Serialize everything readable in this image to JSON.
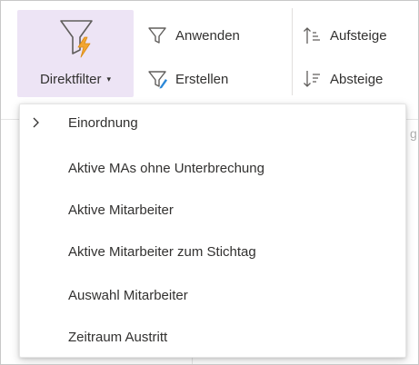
{
  "ribbon": {
    "direktfilter": {
      "label": "Direktfilter",
      "icon": "filter-lightning-icon",
      "caret": "▾"
    },
    "anwenden": {
      "label": "Anwenden",
      "icon": "filter-icon"
    },
    "erstellen": {
      "label": "Erstellen",
      "icon": "filter-edit-icon"
    },
    "aufsteigend": {
      "label": "Aufsteige",
      "icon": "sort-ascending-icon"
    },
    "absteigend": {
      "label": "Absteige",
      "icon": "sort-descending-icon"
    }
  },
  "background": {
    "peek_text": "g"
  },
  "dropdown": {
    "items": [
      {
        "label": "Einordnung",
        "has_submenu": true
      },
      {
        "label": "Aktive MAs ohne Unterbrechung",
        "has_submenu": false
      },
      {
        "label": "Aktive Mitarbeiter",
        "has_submenu": false
      },
      {
        "label": "Aktive Mitarbeiter zum Stichtag",
        "has_submenu": false
      },
      {
        "label": "Auswahl Mitarbeiter",
        "has_submenu": false
      },
      {
        "label": "Zeitraum Austritt",
        "has_submenu": false
      }
    ]
  },
  "colors": {
    "accent_bg": "#ede4f5",
    "lightning": "#f2a531",
    "text": "#323130",
    "icon_stroke": "#605e5c",
    "edit_accent": "#2b88d8"
  }
}
